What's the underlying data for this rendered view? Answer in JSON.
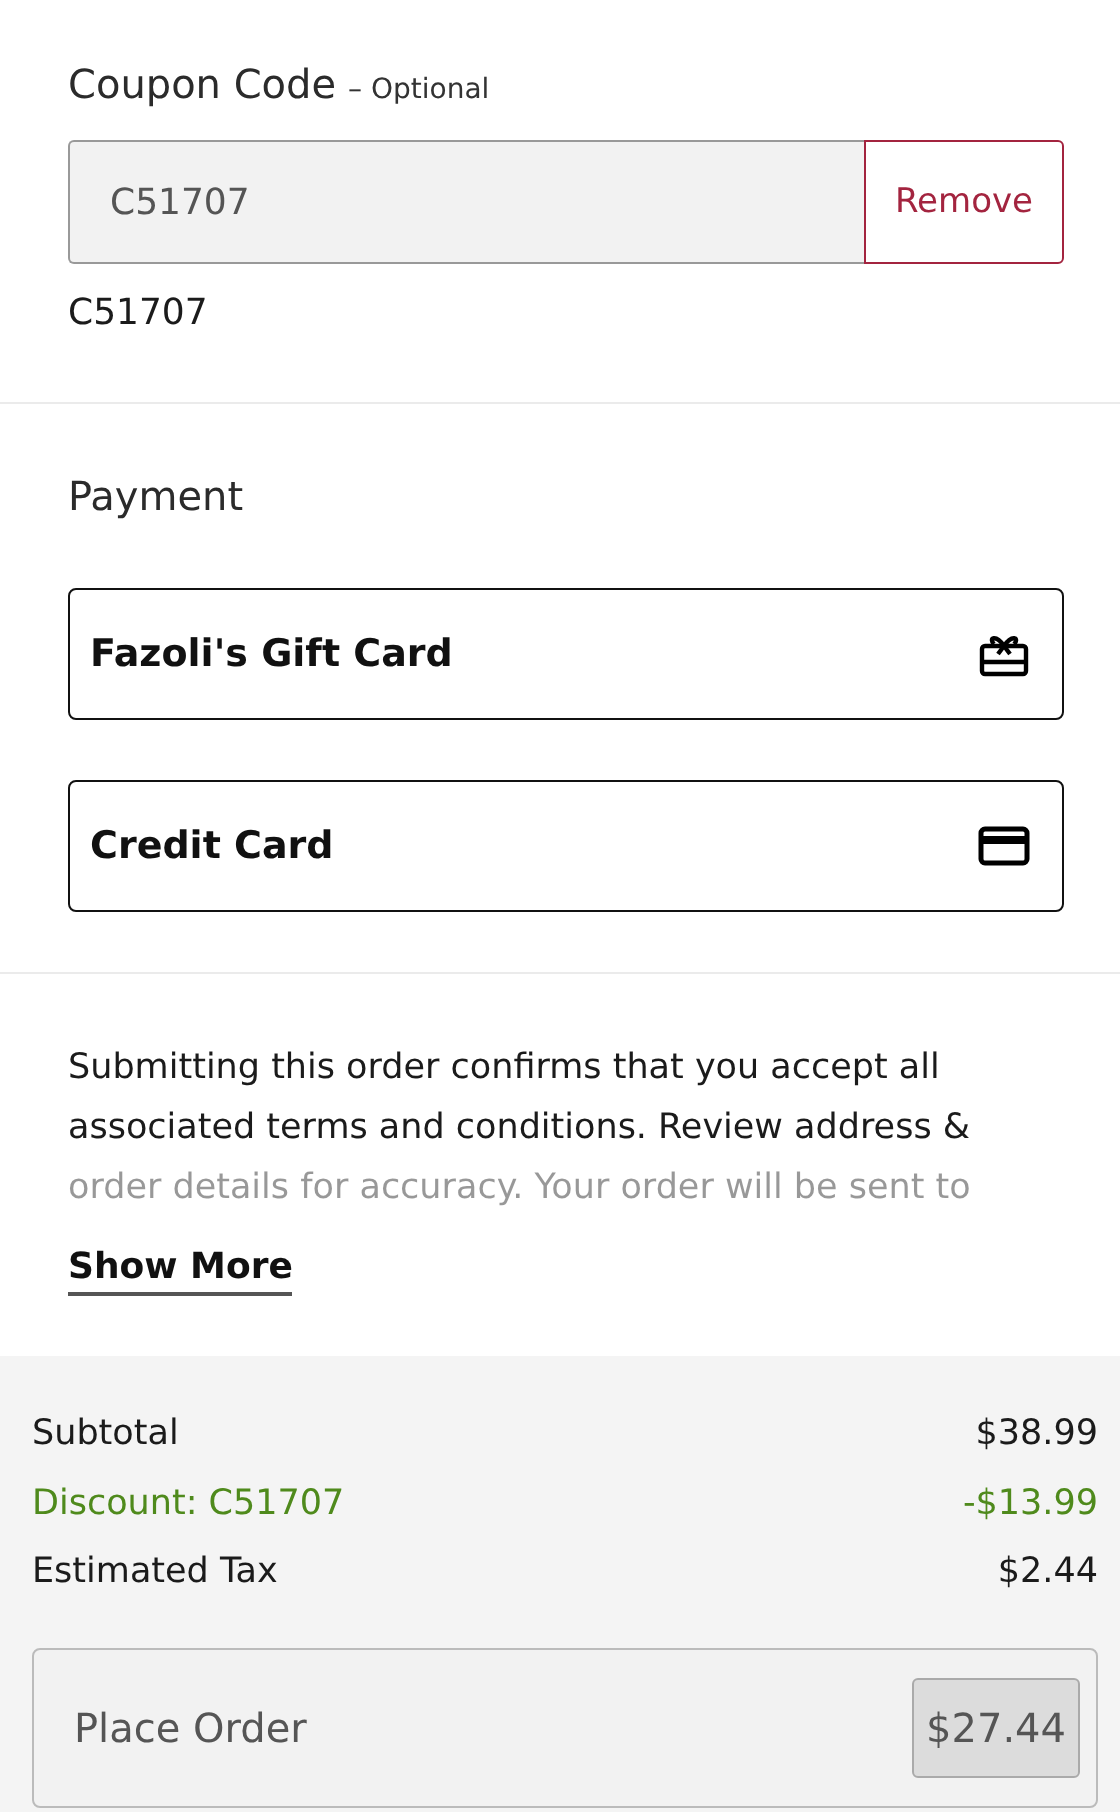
{
  "coupon": {
    "title": "Coupon Code",
    "hint": "– Optional",
    "value": "C51707",
    "remove_button": "Remove",
    "applied_code": "C51707"
  },
  "payment": {
    "title": "Payment",
    "methods": [
      {
        "label": "Fazoli's Gift Card",
        "kind": "gift_card"
      },
      {
        "label": "Credit Card",
        "kind": "credit_card"
      }
    ]
  },
  "terms": {
    "text": "Submitting this order confirms that you accept all associated terms and conditions. Review address & order details for accuracy. Your order will be sent to",
    "show_more": "Show More"
  },
  "summary": [
    {
      "label": "Subtotal",
      "amount": "$38.99",
      "kind": "normal"
    },
    {
      "label": "Discount: C51707",
      "amount": "-$13.99",
      "kind": "discount"
    },
    {
      "label": "Estimated Tax",
      "amount": "$2.44",
      "kind": "normal"
    }
  ],
  "place_order": {
    "label": "Place Order",
    "total": "$27.44",
    "disabled": true
  }
}
